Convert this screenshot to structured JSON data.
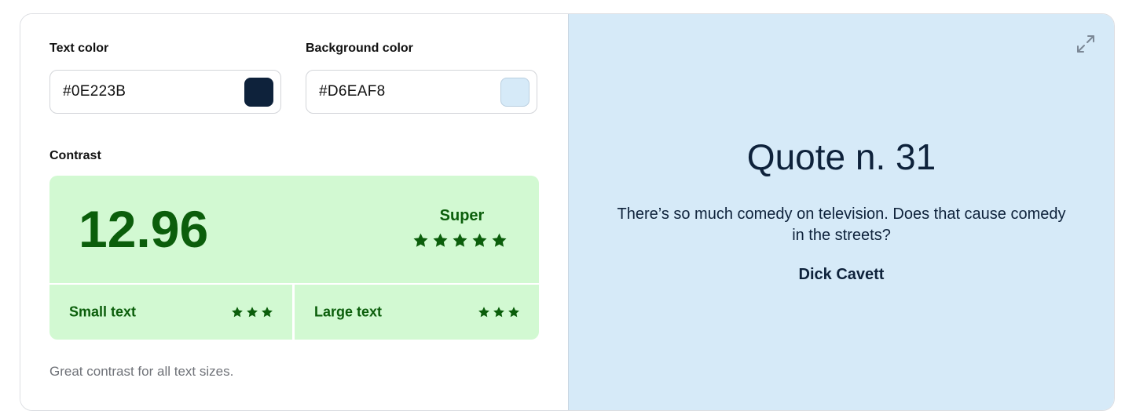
{
  "colors": {
    "text_color": "#0E223B",
    "background_color": "#D6EAF8",
    "rating_bg": "#D2F9D2",
    "rating_fg": "#0B5E0B"
  },
  "text_color_field": {
    "label": "Text color",
    "value": "#0E223B"
  },
  "background_color_field": {
    "label": "Background color",
    "value": "#D6EAF8"
  },
  "contrast": {
    "label": "Contrast",
    "ratio": "12.96",
    "rating_label": "Super",
    "rating_stars": 5,
    "small_text": {
      "label": "Small text",
      "stars": 3
    },
    "large_text": {
      "label": "Large text",
      "stars": 3
    },
    "summary": "Great contrast for all text sizes."
  },
  "preview": {
    "expand_icon": "expand-icon",
    "title": "Quote n. 31",
    "quote": "There’s so much comedy on television. Does that cause comedy in the streets?",
    "author": "Dick Cavett"
  }
}
